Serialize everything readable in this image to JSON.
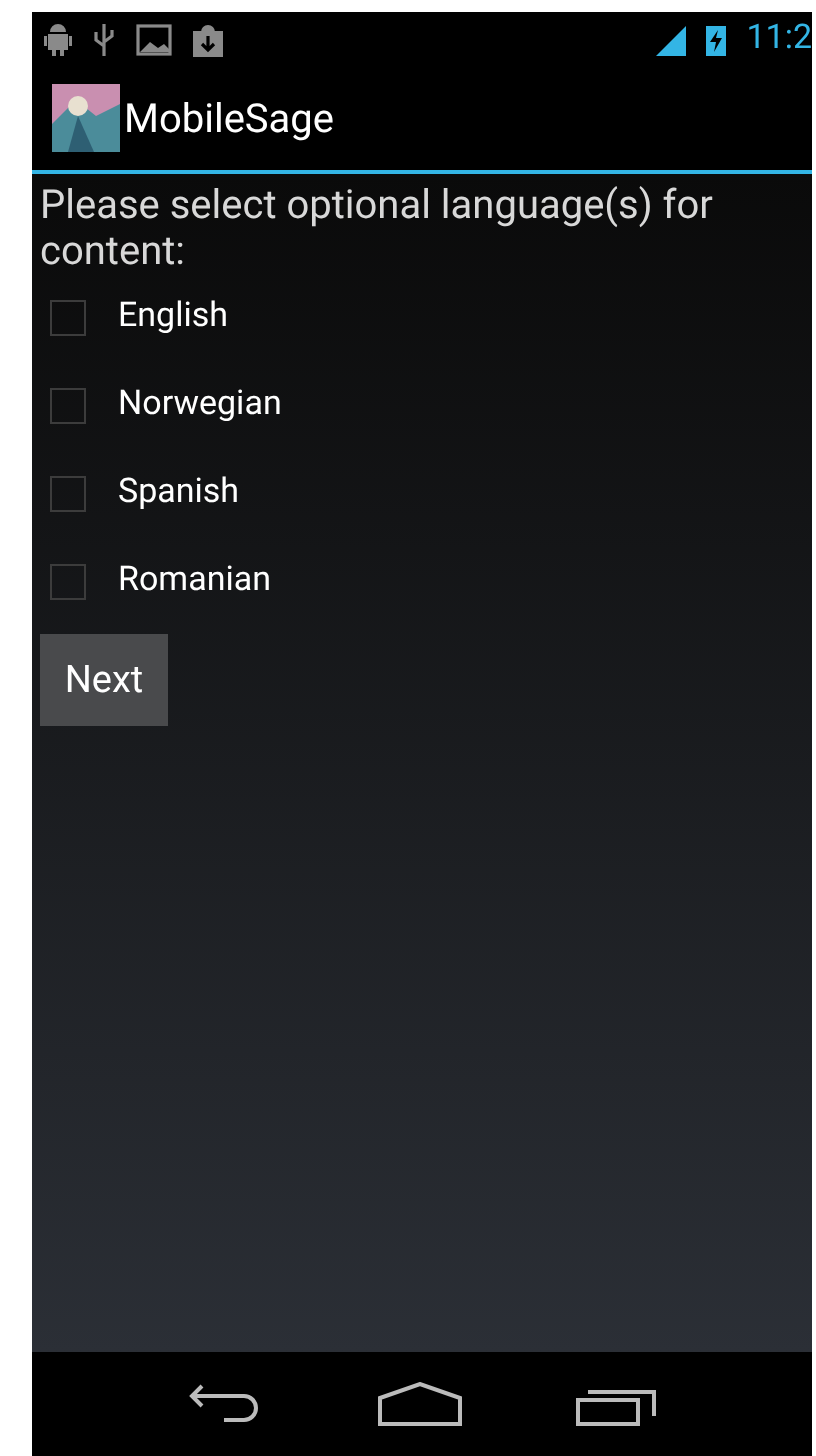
{
  "status_bar": {
    "time": "11:2"
  },
  "action_bar": {
    "title": "MobileSage"
  },
  "prompt": "Please select optional language(s) for content:",
  "languages": [
    {
      "label": "English",
      "checked": false
    },
    {
      "label": "Norwegian",
      "checked": false
    },
    {
      "label": "Spanish",
      "checked": false
    },
    {
      "label": "Romanian",
      "checked": false
    }
  ],
  "next_button": "Next"
}
